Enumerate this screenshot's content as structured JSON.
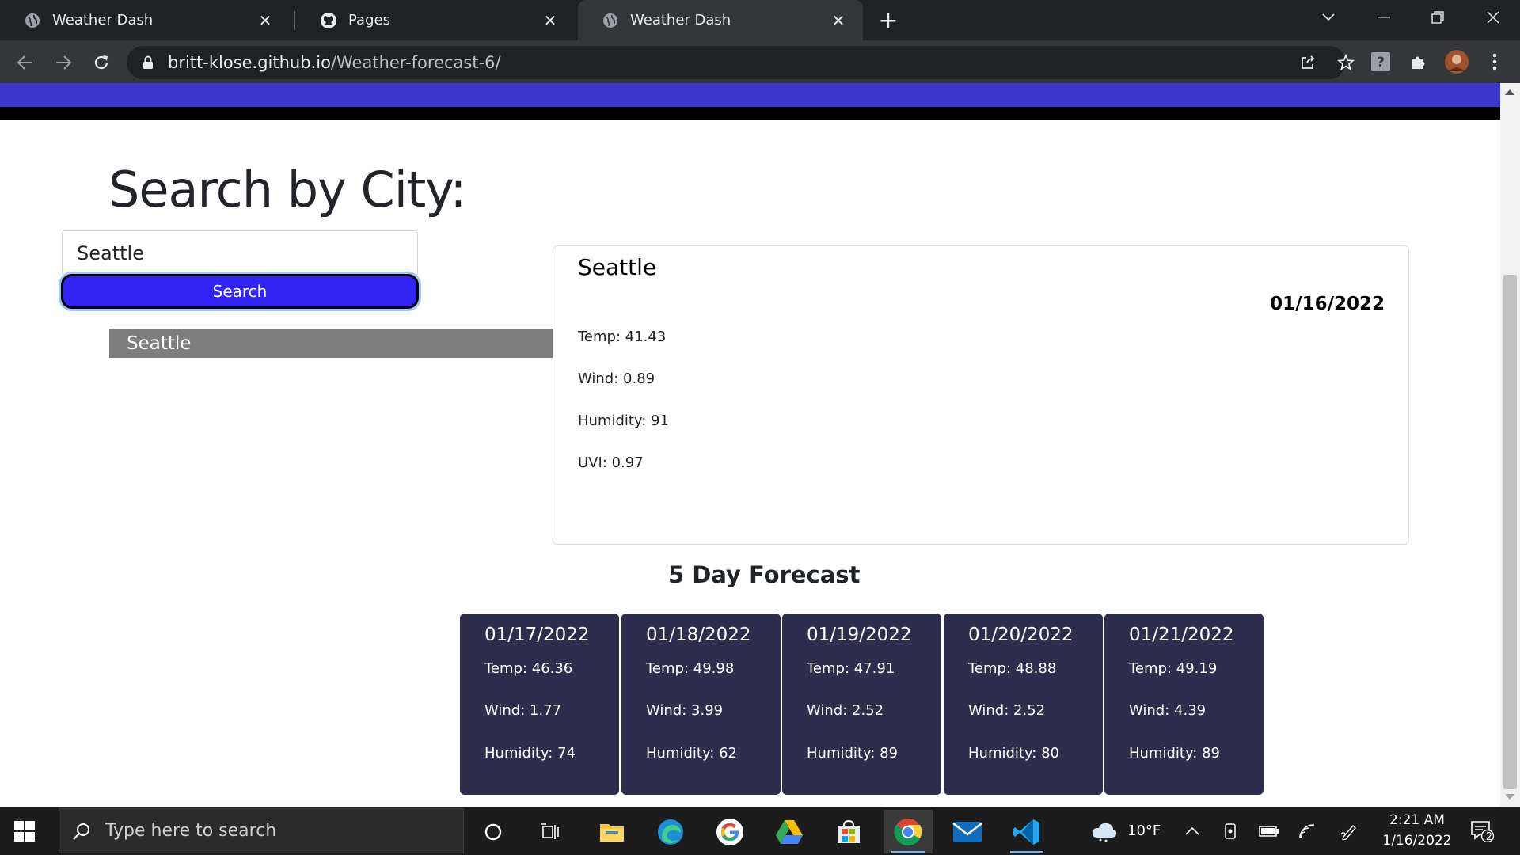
{
  "browser": {
    "tabs": [
      {
        "title": "Weather Dash",
        "active": false
      },
      {
        "title": "Pages",
        "active": false
      },
      {
        "title": "Weather Dash",
        "active": true
      }
    ],
    "url_host": "britt-klose.github.io",
    "url_path": "/Weather-forecast-6/"
  },
  "page": {
    "heading": "Search by City:",
    "search_value": "Seattle",
    "search_button": "Search",
    "history": [
      "Seattle"
    ],
    "current": {
      "city": "Seattle",
      "date": "01/16/2022",
      "temp": "Temp: 41.43",
      "wind": "Wind: 0.89",
      "humidity": "Humidity: 91",
      "uvi": "UVI: 0.97"
    },
    "forecast_title": "5 Day Forecast",
    "forecast": [
      {
        "date": "01/17/2022",
        "temp": "Temp: 46.36",
        "wind": "Wind: 1.77",
        "humidity": "Humidity: 74"
      },
      {
        "date": "01/18/2022",
        "temp": "Temp: 49.98",
        "wind": "Wind: 3.99",
        "humidity": "Humidity: 62"
      },
      {
        "date": "01/19/2022",
        "temp": "Temp: 47.91",
        "wind": "Wind: 2.52",
        "humidity": "Humidity: 89"
      },
      {
        "date": "01/20/2022",
        "temp": "Temp: 48.88",
        "wind": "Wind: 2.52",
        "humidity": "Humidity: 80"
      },
      {
        "date": "01/21/2022",
        "temp": "Temp: 49.19",
        "wind": "Wind: 4.39",
        "humidity": "Humidity: 89"
      }
    ]
  },
  "taskbar": {
    "search_placeholder": "Type here to search",
    "weather_temp": "10°F",
    "time": "2:21 AM",
    "date": "1/16/2022",
    "notification_count": "2"
  },
  "colors": {
    "banner": "#3a37cc",
    "search_button": "#3124f5",
    "forecast_card": "#2e2d4e",
    "history_item": "#7d7d7d"
  }
}
